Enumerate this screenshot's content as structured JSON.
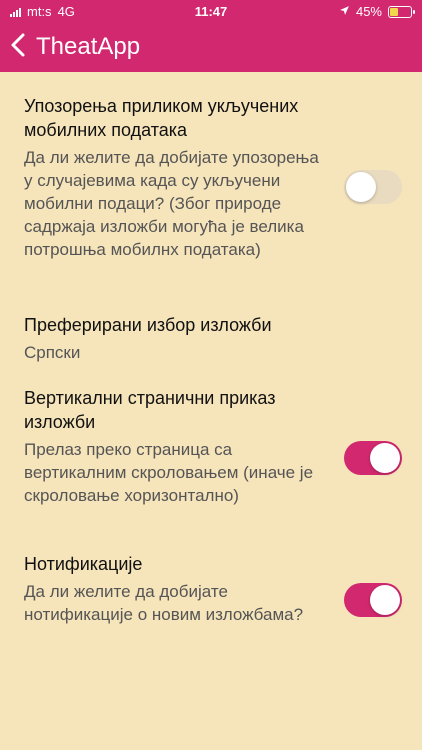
{
  "status_bar": {
    "carrier": "mt:s",
    "network": "4G",
    "time": "11:47",
    "battery_percent": "45%",
    "battery_level": 0.45
  },
  "nav": {
    "back_icon": "chevron-left-icon",
    "title": "TheatApp"
  },
  "settings": [
    {
      "title": "Упозорења приликом укључених мобилних података",
      "description": "Да ли желите да добијате упозорења у случајевима када су укључени мобилни подаци? (Због природе садржаја изложби могућа је велика потрошња мобилнх података)",
      "toggle": false
    },
    {
      "title": "Преферирани избор изложби",
      "description": "Српски"
    },
    {
      "title": "Вертикални странични приказ изложби",
      "description": "Прелаз преко страница са вертикалним скроловањем (иначе је скроловање хоризонтално)",
      "toggle": true
    },
    {
      "title": "Нотификације",
      "description": "Да ли желите да добијате нотификације о новим изложбама?",
      "toggle": true
    }
  ],
  "colors": {
    "accent": "#d2286f",
    "background": "#f6e4bb"
  }
}
